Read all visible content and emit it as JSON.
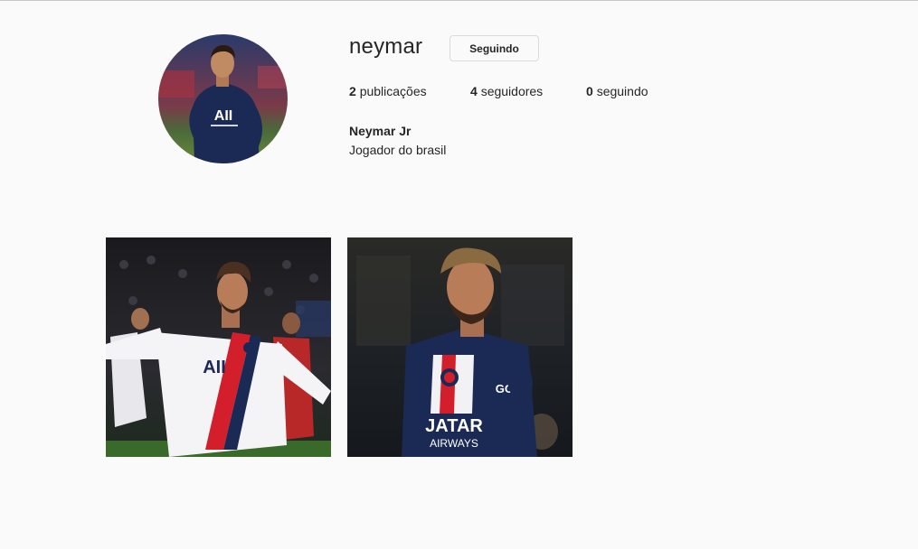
{
  "profile": {
    "username": "neymar",
    "follow_button_label": "Seguindo",
    "stats": {
      "posts_count": "2",
      "posts_label": "publicações",
      "followers_count": "4",
      "followers_label": "seguidores",
      "following_count": "0",
      "following_label": "seguindo"
    },
    "full_name": "Neymar Jr",
    "bio": "Jogador do brasil"
  },
  "colors": {
    "background": "#fafafa",
    "text": "#262626",
    "border": "#dbdbdb",
    "psg_navy": "#1b2a55",
    "psg_red": "#d21f2b"
  }
}
